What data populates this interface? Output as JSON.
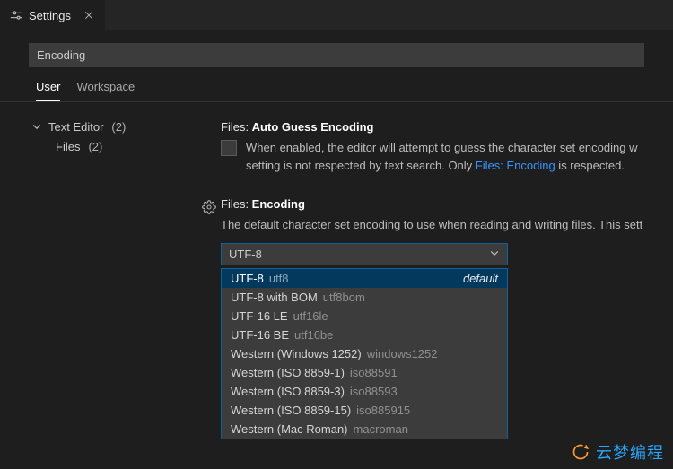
{
  "tab": {
    "title": "Settings"
  },
  "search": {
    "value": "Encoding"
  },
  "scopes": {
    "user": "User",
    "workspace": "Workspace"
  },
  "tree": {
    "node": {
      "label": "Text Editor",
      "count": "(2)"
    },
    "child": {
      "label": "Files",
      "count": "(2)"
    }
  },
  "settingA": {
    "prefix": "Files: ",
    "name": "Auto Guess Encoding",
    "desc1": "When enabled, the editor will attempt to guess the character set encoding w",
    "desc2a": "setting is not respected by text search. Only ",
    "desc2link": "Files: Encoding",
    "desc2b": " is respected."
  },
  "settingB": {
    "prefix": "Files: ",
    "name": "Encoding",
    "desc": "The default character set encoding to use when reading and writing files. This sett",
    "selected": "UTF-8"
  },
  "options": [
    {
      "label": "UTF-8",
      "id": "utf8",
      "badge": "default",
      "selected": true
    },
    {
      "label": "UTF-8 with BOM",
      "id": "utf8bom"
    },
    {
      "label": "UTF-16 LE",
      "id": "utf16le"
    },
    {
      "label": "UTF-16 BE",
      "id": "utf16be"
    },
    {
      "label": "Western (Windows 1252)",
      "id": "windows1252"
    },
    {
      "label": "Western (ISO 8859-1)",
      "id": "iso88591"
    },
    {
      "label": "Western (ISO 8859-3)",
      "id": "iso88593"
    },
    {
      "label": "Western (ISO 8859-15)",
      "id": "iso885915"
    },
    {
      "label": "Western (Mac Roman)",
      "id": "macroman"
    }
  ],
  "watermark": "云梦编程"
}
